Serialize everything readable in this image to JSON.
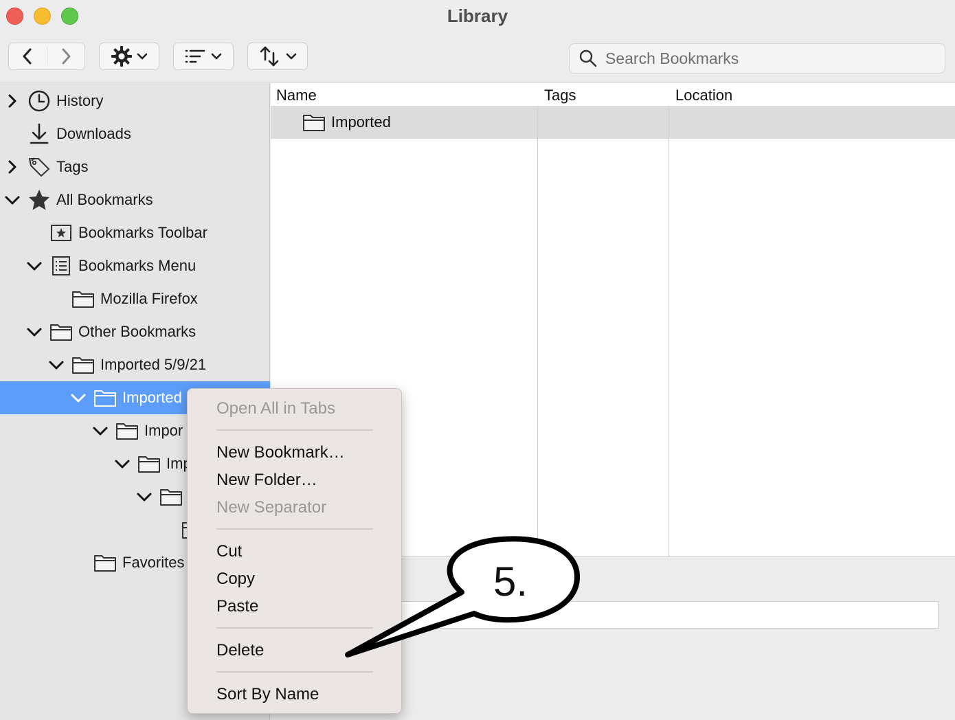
{
  "window": {
    "title": "Library"
  },
  "toolbar": {
    "back_icon": "chevron-left-icon",
    "forward_icon": "chevron-right-icon",
    "organize_icon": "gear-icon",
    "views_icon": "list-icon",
    "import_export_icon": "up-down-arrows-icon"
  },
  "search": {
    "placeholder": "Search Bookmarks",
    "value": ""
  },
  "sidebar": {
    "items": [
      {
        "label": "History",
        "icon": "clock-icon"
      },
      {
        "label": "Downloads",
        "icon": "download-icon"
      },
      {
        "label": "Tags",
        "icon": "tag-icon"
      },
      {
        "label": "All Bookmarks",
        "icon": "star-icon"
      },
      {
        "label": "Bookmarks Toolbar",
        "icon": "toolbar-star-icon"
      },
      {
        "label": "Bookmarks Menu",
        "icon": "menu-list-icon"
      },
      {
        "label": "Mozilla Firefox",
        "icon": "folder-icon"
      },
      {
        "label": "Other Bookmarks",
        "icon": "folder-icon"
      },
      {
        "label": "Imported 5/9/21",
        "icon": "folder-icon"
      },
      {
        "label": "Imported",
        "icon": "folder-icon",
        "selected": true
      },
      {
        "label": "Impor",
        "icon": "folder-icon"
      },
      {
        "label": "Imp",
        "icon": "folder-icon"
      },
      {
        "label": "",
        "icon": "folder-icon"
      },
      {
        "label": "",
        "icon": "folder-icon"
      },
      {
        "label": "Favorites",
        "icon": "folder-icon"
      }
    ]
  },
  "list": {
    "columns": [
      "Name",
      "Tags",
      "Location"
    ],
    "rows": [
      {
        "name": "Imported",
        "tags": "",
        "location": ""
      }
    ]
  },
  "context_menu": {
    "items": [
      {
        "label": "Open All in Tabs",
        "enabled": false
      },
      {
        "label": "New Bookmark…",
        "enabled": true
      },
      {
        "label": "New Folder…",
        "enabled": true
      },
      {
        "label": "New Separator",
        "enabled": false
      },
      {
        "label": "Cut",
        "enabled": true
      },
      {
        "label": "Copy",
        "enabled": true
      },
      {
        "label": "Paste",
        "enabled": true
      },
      {
        "label": "Delete",
        "enabled": true
      },
      {
        "label": "Sort By Name",
        "enabled": true
      }
    ]
  },
  "annotation": {
    "label": "5."
  },
  "colors": {
    "selection": "#5c9dfa",
    "close": "#ee5f57",
    "minimize": "#f6be2f",
    "maximize": "#5fc84d"
  }
}
